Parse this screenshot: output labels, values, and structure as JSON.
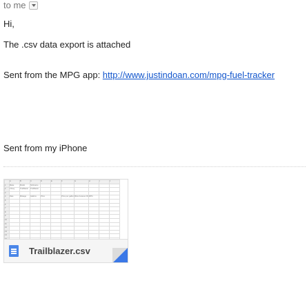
{
  "header": {
    "to_label": "to me"
  },
  "message": {
    "greeting": "Hi,",
    "line1": "The .csv data export is attached",
    "sent_from_app_prefix": "Sent from the MPG app: ",
    "app_link": "http://www.justindoan.com/mpg-fuel-tracker",
    "signature": "Sent from my iPhone"
  },
  "attachment": {
    "filename": "Trailblazer.csv",
    "icon": "spreadsheet-file-icon",
    "preview_rows": [
      [
        "",
        "A",
        "B",
        "C",
        "D",
        "E",
        "F",
        "G",
        "H",
        "I",
        "J"
      ],
      [
        "1",
        "Make",
        "Model",
        "Nickname",
        "",
        "",
        "",
        "",
        "",
        "",
        ""
      ],
      [
        "2",
        "Chevy",
        "Trailblazer",
        "Trailblazer",
        "",
        "",
        "",
        "",
        "",
        "",
        ""
      ],
      [
        "3",
        "",
        "",
        "",
        "",
        "",
        "",
        "",
        "",
        "",
        ""
      ],
      [
        "4",
        "Date",
        "Mileage",
        "Gallons",
        "Price",
        "",
        "Price per gallon",
        "Miles between fill",
        "MPG",
        "",
        ""
      ],
      [
        "5",
        "",
        "",
        "",
        "",
        "",
        "",
        "",
        "",
        "",
        ""
      ],
      [
        "6",
        "",
        "",
        "",
        "",
        "",
        "",
        "",
        "",
        "",
        ""
      ],
      [
        "7",
        "",
        "",
        "",
        "",
        "",
        "",
        "",
        "",
        "",
        ""
      ],
      [
        "8",
        "",
        "",
        "",
        "",
        "",
        "",
        "",
        "",
        "",
        ""
      ],
      [
        "9",
        "",
        "",
        "",
        "",
        "",
        "",
        "",
        "",
        "",
        ""
      ],
      [
        "10",
        "",
        "",
        "",
        "",
        "",
        "",
        "",
        "",
        "",
        ""
      ],
      [
        "11",
        "",
        "",
        "",
        "",
        "",
        "",
        "",
        "",
        "",
        ""
      ],
      [
        "12",
        "",
        "",
        "",
        "",
        "",
        "",
        "",
        "",
        "",
        ""
      ],
      [
        "13",
        "",
        "",
        "",
        "",
        "",
        "",
        "",
        "",
        "",
        ""
      ],
      [
        "14",
        "",
        "",
        "",
        "",
        "",
        "",
        "",
        "",
        "",
        ""
      ],
      [
        "15",
        "",
        "",
        "",
        "",
        "",
        "",
        "",
        "",
        "",
        ""
      ],
      [
        "16",
        "",
        "",
        "",
        "",
        "",
        "",
        "",
        "",
        "",
        ""
      ],
      [
        "17",
        "",
        "",
        "",
        "",
        "",
        "",
        "",
        "",
        "",
        ""
      ]
    ]
  }
}
